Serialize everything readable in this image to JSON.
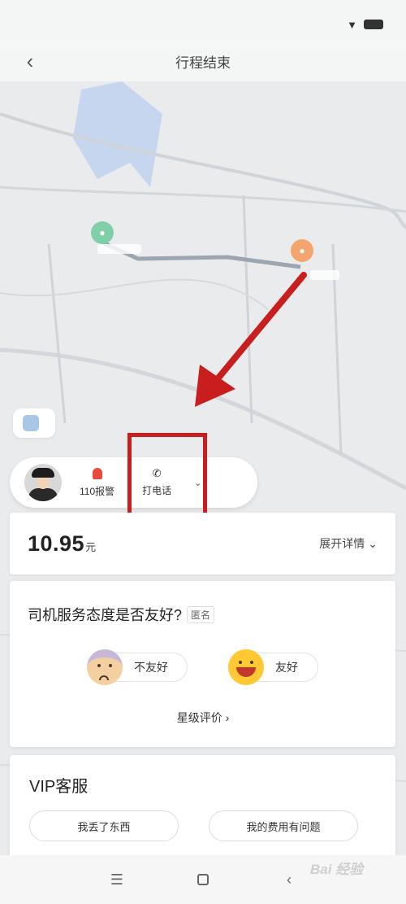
{
  "header": {
    "title": "行程结束"
  },
  "map": {
    "location_chip_label": "",
    "colors": {
      "water": "#c6d6ee",
      "route": "#9ba6b1",
      "start_pin": "#7fcfa9",
      "end_pin": "#f4a46d"
    }
  },
  "driver_bar": {
    "alert_label": "110报警",
    "call_label": "打电话",
    "chevron_icon": "chevron-down-icon"
  },
  "fare": {
    "amount": "10.95",
    "unit": "元",
    "detail_label": "展开详情"
  },
  "rating": {
    "question": "司机服务态度是否友好?",
    "anonymous_badge": "匿名",
    "unfriendly_label": "不友好",
    "friendly_label": "友好",
    "star_link": "星级评价"
  },
  "vip": {
    "title": "VIP客服",
    "buttons": [
      {
        "label": "我丢了东西"
      },
      {
        "label": "我的费用有问题"
      }
    ]
  },
  "annotation": {
    "highlight_color": "#c81e1e"
  },
  "watermark": "Bai 经验"
}
